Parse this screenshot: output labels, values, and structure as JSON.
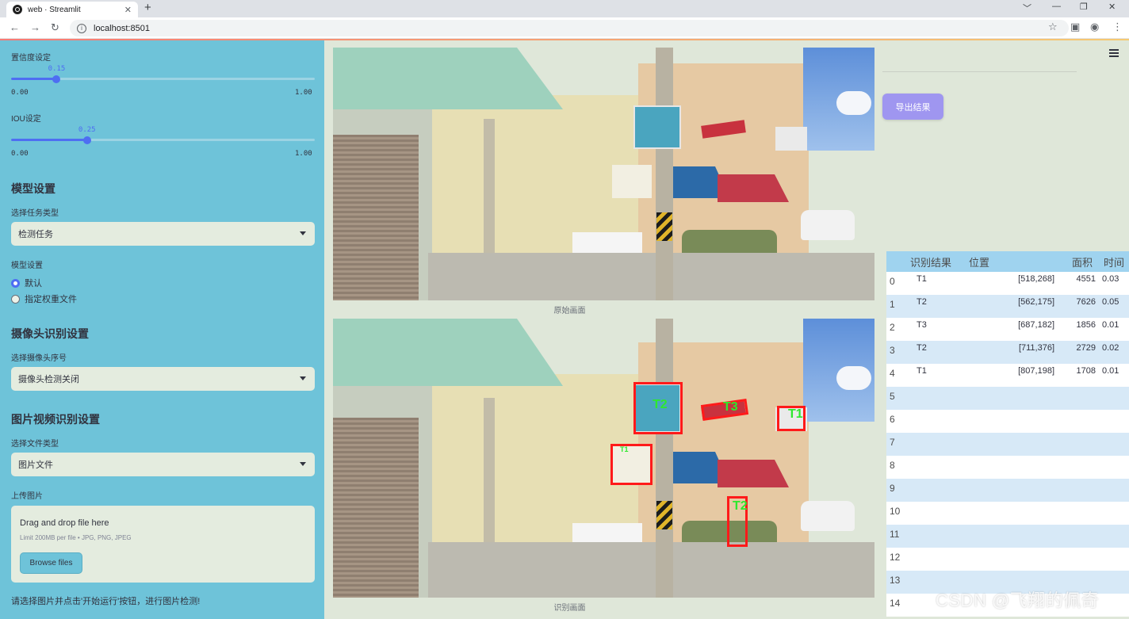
{
  "browser": {
    "tab_title": "web · Streamlit",
    "new_tab": "+",
    "url": "localhost:8501",
    "window_controls": [
      "﹀",
      "—",
      "❐",
      "✕"
    ]
  },
  "sidebar": {
    "conf_label": "置信度设定",
    "conf_value": "0.15",
    "conf_fraction": 0.15,
    "conf_min": "0.00",
    "conf_max": "1.00",
    "iou_label": "IOU设定",
    "iou_value": "0.25",
    "iou_fraction": 0.25,
    "iou_min": "0.00",
    "iou_max": "1.00",
    "model_header": "模型设置",
    "task_label": "选择任务类型",
    "task_value": "检测任务",
    "model_label": "模型设置",
    "radio_default": "默认",
    "radio_custom": "指定权重文件",
    "camera_header": "摄像头识别设置",
    "camera_label": "选择摄像头序号",
    "camera_value": "摄像头检测关闭",
    "media_header": "图片视频识别设置",
    "filetype_label": "选择文件类型",
    "filetype_value": "图片文件",
    "upload_label": "上传图片",
    "drop_text": "Drag and drop file here",
    "limit_text": "Limit 200MB per file • JPG, PNG, JPEG",
    "browse_label": "Browse files",
    "info_text": "请选择图片并点击'开始运行'按钮，进行图片检测!"
  },
  "main": {
    "original_caption": "原始画面",
    "result_caption": "识别画面",
    "detections": [
      {
        "label": "T2"
      },
      {
        "label": "T3"
      },
      {
        "label": "T1"
      },
      {
        "label": "T1"
      },
      {
        "label": "T2"
      }
    ]
  },
  "right": {
    "export_label": "导出结果",
    "table": {
      "headers": [
        "",
        "识别结果",
        "位置",
        "面积",
        "时间"
      ],
      "rows": [
        [
          "0",
          "T1",
          "[518,268]",
          "4551",
          "0.03"
        ],
        [
          "1",
          "T2",
          "[562,175]",
          "7626",
          "0.05"
        ],
        [
          "2",
          "T3",
          "[687,182]",
          "1856",
          "0.01"
        ],
        [
          "3",
          "T2",
          "[711,376]",
          "2729",
          "0.02"
        ],
        [
          "4",
          "T1",
          "[807,198]",
          "1708",
          "0.01"
        ],
        [
          "5",
          "",
          "",
          "",
          ""
        ],
        [
          "6",
          "",
          "",
          "",
          ""
        ],
        [
          "7",
          "",
          "",
          "",
          ""
        ],
        [
          "8",
          "",
          "",
          "",
          ""
        ],
        [
          "9",
          "",
          "",
          "",
          ""
        ],
        [
          "10",
          "",
          "",
          "",
          ""
        ],
        [
          "11",
          "",
          "",
          "",
          ""
        ],
        [
          "12",
          "",
          "",
          "",
          ""
        ],
        [
          "13",
          "",
          "",
          "",
          ""
        ],
        [
          "14",
          "",
          "",
          "",
          ""
        ]
      ]
    }
  },
  "watermark": "CSDN @飞翔的佩奇",
  "colors": {
    "sidebar_bg": "#6ec3d9",
    "accent": "#4e6ef2",
    "export_btn": "#9f96f0",
    "box_color": "#ff1a1a",
    "box_label_color": "#2ee82e"
  }
}
